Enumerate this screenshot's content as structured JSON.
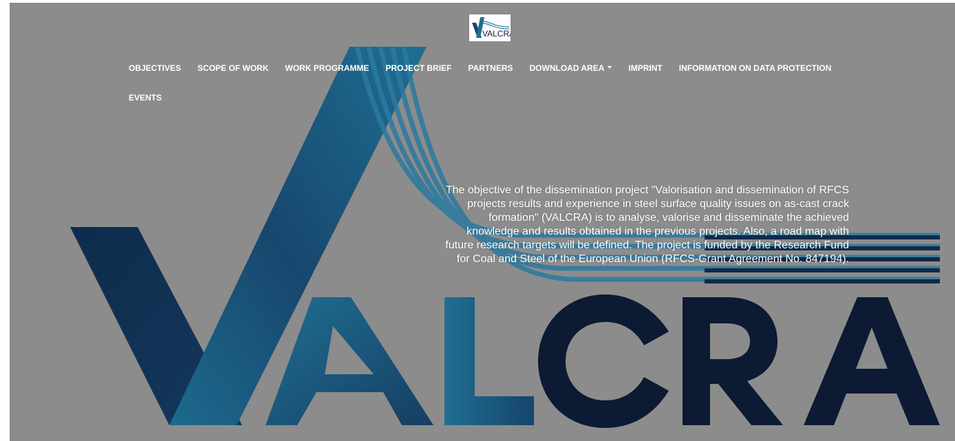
{
  "logo": {
    "text": "VALCRA",
    "alt": "VALCRA logo"
  },
  "nav": {
    "items": [
      {
        "label": "OBJECTIVES"
      },
      {
        "label": "SCOPE OF WORK"
      },
      {
        "label": "WORK PROGRAMME"
      },
      {
        "label": "PROJECT BRIEF"
      },
      {
        "label": "PARTNERS"
      },
      {
        "label": "DOWNLOAD AREA",
        "dropdown": true
      },
      {
        "label": "IMPRINT"
      },
      {
        "label": "INFORMATION ON DATA PROTECTION"
      }
    ],
    "second_row": [
      {
        "label": "EVENTS"
      }
    ]
  },
  "hero": {
    "wordmark": "VALCRA",
    "intro": "The objective of the dissemination project \"Valorisation and dissemination of RFCS projects results and experience in steel surface quality issues on as-cast crack formation\" (VALCRA) is to analyse, valorise and disseminate the achieved knowledge and results obtained in the previous projects. Also, a road map with future research targets will be defined. The project is funded by the Research Fund for Coal and Steel of the European Union (RFCS-Grant Agreement No. 847194)."
  },
  "colors": {
    "overlay": "#8c8c8c",
    "brand_dark": "#0c1a33",
    "brand_teal": "#1f6f92",
    "brand_mid": "#17476e"
  }
}
